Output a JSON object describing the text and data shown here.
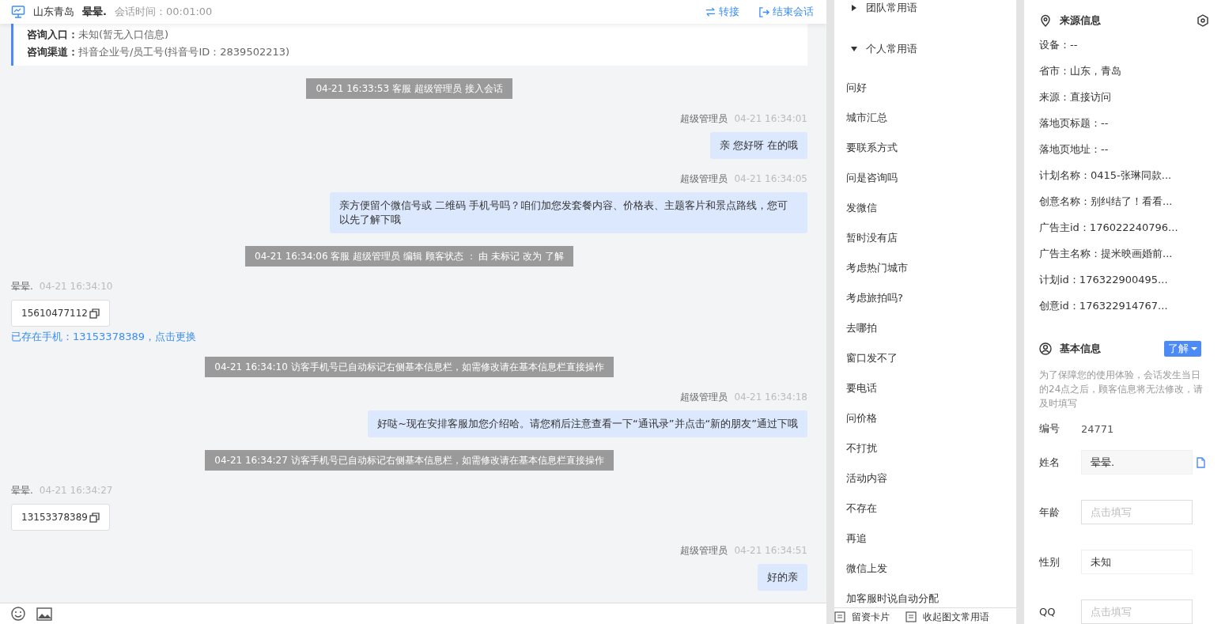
{
  "chat": {
    "header": {
      "location": "山东青岛",
      "visitor": "晕晕.",
      "session_time": "会话时间：00:01:00",
      "actions": [
        {
          "kind": "transfer",
          "label": "转接"
        },
        {
          "kind": "end",
          "label": "结束会话"
        }
      ]
    },
    "info_card": [
      "**咨询入口：**未知(暂无入口信息)",
      "**咨询渠道：**抖音企业号/员工号(抖音号ID：2839502213)"
    ],
    "messages": [
      {
        "kind": "system",
        "text": "04-21 16:33:53 客服 超级管理员 接入会话"
      },
      {
        "kind": "agent",
        "sender": "超级管理员",
        "time": "04-21 16:34:01",
        "text": "亲 您好呀 在的哦"
      },
      {
        "kind": "agent",
        "sender": "超级管理员",
        "time": "04-21 16:34:05",
        "text": "亲方便留个微信号或 二维码 手机号吗？咱们加您发套餐内容、价格表、主题客片和景点路线，您可以先了解下哦"
      },
      {
        "kind": "system",
        "text": "04-21 16:34:06 客服 超级管理员 编辑 顾客状态 ： 由 未标记 改为 了解"
      },
      {
        "kind": "visitor",
        "sender": "晕晕.",
        "time": "04-21 16:34:10",
        "phone": "15610477112",
        "note": "已存在手机：13153378389，点击更换"
      },
      {
        "kind": "system",
        "text": "04-21 16:34:10 访客手机号已自动标记右侧基本信息栏，如需修改请在基本信息栏直接操作"
      },
      {
        "kind": "agent",
        "sender": "超级管理员",
        "time": "04-21 16:34:18",
        "text": "好哒~现在安排客服加您介绍哈。请您稍后注意查看一下“通讯录”并点击“新的朋友”通过下哦"
      },
      {
        "kind": "system",
        "text": "04-21 16:34:27 访客手机号已自动标记右侧基本信息栏，如需修改请在基本信息栏直接操作"
      },
      {
        "kind": "visitor",
        "sender": "晕晕.",
        "time": "04-21 16:34:27",
        "phone": "13153378389"
      },
      {
        "kind": "agent",
        "sender": "超级管理员",
        "time": "04-21 16:34:51",
        "text": "好的亲"
      }
    ]
  },
  "phrases": {
    "groups": [
      {
        "label": "团队常用语",
        "expanded": false
      },
      {
        "label": "个人常用语",
        "expanded": true,
        "items": [
          "问好",
          "城市汇总",
          "要联系方式",
          "问是咨询吗",
          "发微信",
          "暂时没有店",
          "考虑热门城市",
          "考虑旅拍吗?",
          "去哪拍",
          "窗口发不了",
          "要电话",
          "问价格",
          "不打扰",
          "活动内容",
          "不存在",
          "再追",
          "微信上发",
          "加客服时说自动分配"
        ]
      }
    ],
    "footer": [
      "留资卡片",
      "收起图文常用语"
    ]
  },
  "source_info": {
    "title": "来源信息",
    "rows": [
      "设备：--",
      "省市：山东，青岛",
      "来源：直接访问",
      "落地页标题：--",
      "落地页地址：--",
      "计划名称：0415-张琳同款...",
      "创意名称：别纠结了！看看...",
      "广告主id：176022240796...",
      "广告主名称：提米映画婚前...",
      "计划id：176322900495...",
      "创意id：176322914767..."
    ]
  },
  "basic_info": {
    "title": "基本信息",
    "status": "了解",
    "notice": "为了保障您的使用体验，会话发生当日的24点之后，顾客信息将无法修改，请及时填写",
    "fields": [
      {
        "kind": "text",
        "label": "编号",
        "value": "24771"
      },
      {
        "kind": "readonly",
        "label": "姓名",
        "value": "晕晕."
      },
      {
        "kind": "input",
        "label": "年龄",
        "placeholder": "点击填写"
      },
      {
        "kind": "select",
        "label": "性别",
        "value": "未知"
      },
      {
        "kind": "input",
        "label": "QQ",
        "placeholder": "点击填写"
      }
    ]
  }
}
